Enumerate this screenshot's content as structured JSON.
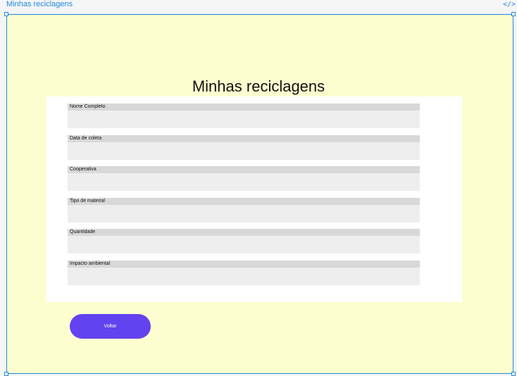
{
  "frame": {
    "label": "Minhas reciclagens",
    "code_icon": "</>"
  },
  "page": {
    "title": "Minhas reciclagens"
  },
  "form": {
    "fields": [
      {
        "label": "Nome Completo",
        "value": ""
      },
      {
        "label": "Data de coleta",
        "value": ""
      },
      {
        "label": "Cooperativa",
        "value": ""
      },
      {
        "label": "Tipo de material",
        "value": ""
      },
      {
        "label": "Quantidade",
        "value": ""
      },
      {
        "label": "Impacto ambiental",
        "value": ""
      }
    ]
  },
  "actions": {
    "back_label": "Voltar"
  },
  "colors": {
    "canvas_bg": "#fdfed0",
    "selection": "#1e88e5",
    "primary_button": "#6243ef"
  }
}
